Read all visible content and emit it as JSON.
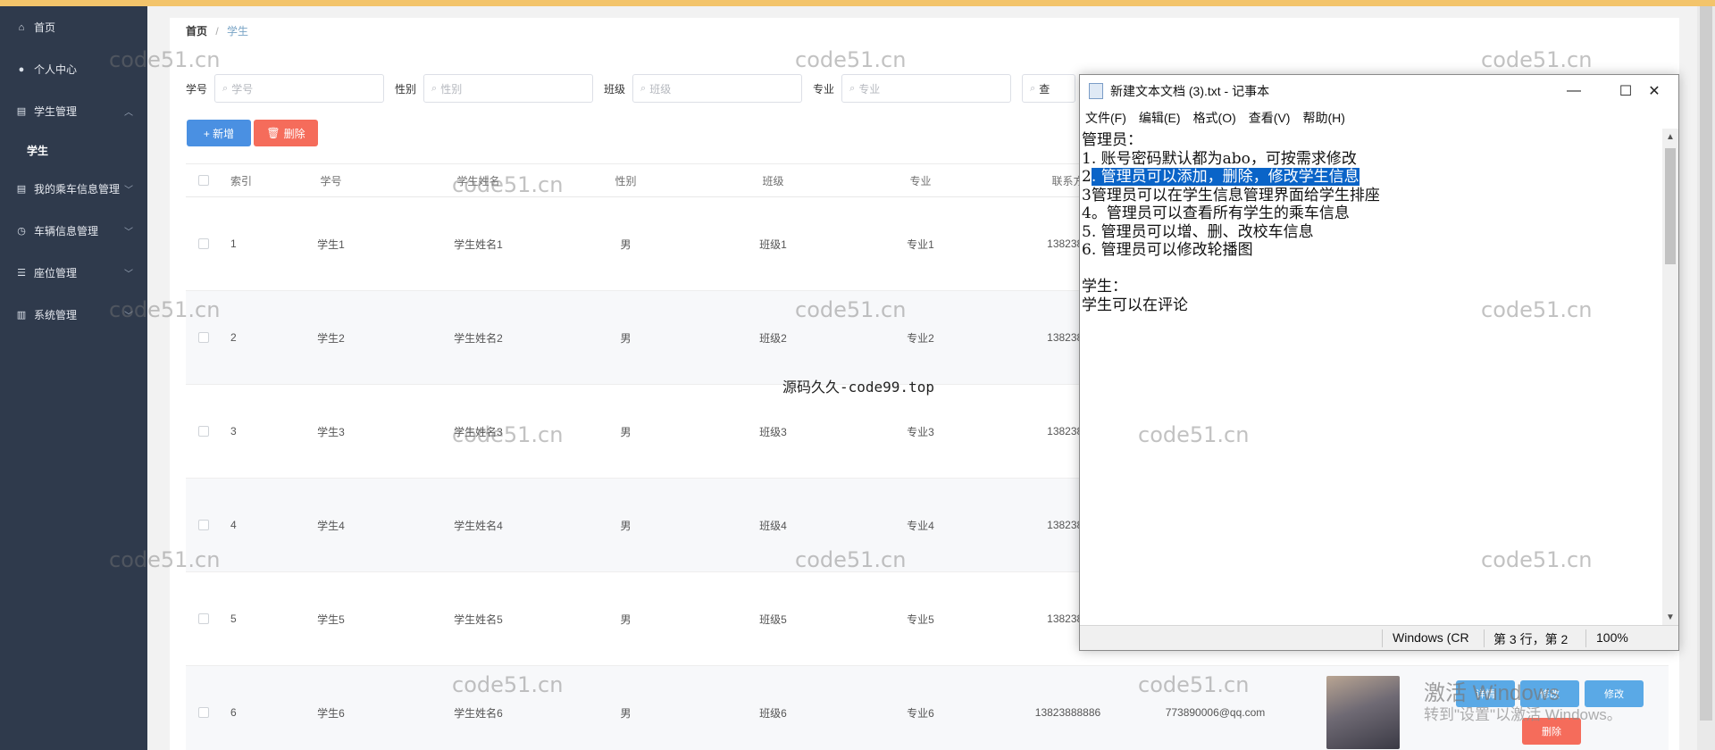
{
  "sidebar": {
    "items": [
      {
        "label": "首页",
        "icon": "home-icon"
      },
      {
        "label": "个人中心",
        "icon": "user-icon"
      },
      {
        "label": "学生管理",
        "icon": "doc-icon"
      },
      {
        "label": "我的乘车信息管理",
        "icon": "doc-icon"
      },
      {
        "label": "车辆信息管理",
        "icon": "clock-icon"
      },
      {
        "label": "座位管理",
        "icon": "list-icon"
      },
      {
        "label": "系统管理",
        "icon": "db-icon"
      }
    ],
    "sub_item": "学生"
  },
  "breadcrumb": {
    "home": "首页",
    "sep": "/",
    "current": "学生"
  },
  "filters": [
    {
      "label": "学号",
      "placeholder": "学号"
    },
    {
      "label": "性别",
      "placeholder": "性别"
    },
    {
      "label": "班级",
      "placeholder": "班级"
    },
    {
      "label": "专业",
      "placeholder": "专业"
    },
    {
      "label": "",
      "placeholder": "查"
    }
  ],
  "buttons": {
    "add": "+ 新增",
    "delete": "删除"
  },
  "table": {
    "headers": [
      "索引",
      "学号",
      "学生姓名",
      "性别",
      "班级",
      "专业",
      "联系方"
    ],
    "rows": [
      {
        "idx": "1",
        "xh": "学生1",
        "name": "学生姓名1",
        "sex": "男",
        "cls": "班级1",
        "major": "专业1",
        "phone": "1382388"
      },
      {
        "idx": "2",
        "xh": "学生2",
        "name": "学生姓名2",
        "sex": "男",
        "cls": "班级2",
        "major": "专业2",
        "phone": "1382388"
      },
      {
        "idx": "3",
        "xh": "学生3",
        "name": "学生姓名3",
        "sex": "男",
        "cls": "班级3",
        "major": "专业3",
        "phone": "1382388"
      },
      {
        "idx": "4",
        "xh": "学生4",
        "name": "学生姓名4",
        "sex": "男",
        "cls": "班级4",
        "major": "专业4",
        "phone": "1382388"
      },
      {
        "idx": "5",
        "xh": "学生5",
        "name": "学生姓名5",
        "sex": "男",
        "cls": "班级5",
        "major": "专业5",
        "phone": "1382388"
      },
      {
        "idx": "6",
        "xh": "学生6",
        "name": "学生姓名6",
        "sex": "男",
        "cls": "班级6",
        "major": "专业6",
        "phone": "13823888886",
        "email": "773890006@qq.com"
      }
    ],
    "row_ops": {
      "detail": "详情",
      "edit_a": "修改",
      "edit_b": "修改",
      "delete": "删除"
    }
  },
  "notepad": {
    "title": "新建文本文档 (3).txt - 记事本",
    "menu": [
      "文件(F)",
      "编辑(E)",
      "格式(O)",
      "查看(V)",
      "帮助(H)"
    ],
    "lines": {
      "l1": "管理员：",
      "l2": "1. 账号密码默认都为abo，可按需求修改",
      "l3_pre": "2",
      "l3_sel": ". 管理员可以添加，删除，修改学生信息",
      "l4": "3管理员可以在学生信息管理界面给学生排座",
      "l5": "4。管理员可以查看所有学生的乘车信息",
      "l6": "5. 管理员可以增、删、改校车信息",
      "l7": "6. 管理员可以修改轮播图",
      "l8": "",
      "l9": "学生：",
      "l10": "学生可以在评论"
    },
    "status": {
      "encoding": "Windows (CR",
      "position": "第 3 行，第 2",
      "zoom": "100%"
    }
  },
  "watermarks": {
    "site": "code51.cn",
    "center": "源码久久-code99.top",
    "activate": "激活 Windows",
    "activate_hint": "转到\"设置\"以激活 Windows。"
  },
  "colors": {
    "sidebar": "#2f3a4c",
    "accent": "#4a90e2",
    "danger": "#f56c5b",
    "selection": "#0a64c8"
  }
}
